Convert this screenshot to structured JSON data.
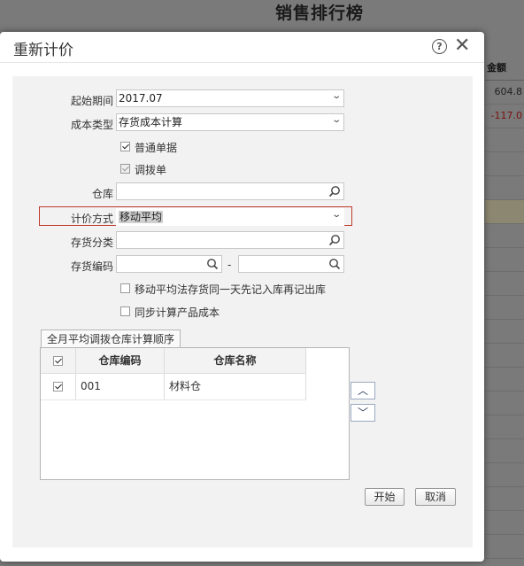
{
  "background": {
    "report_title": "销售排行榜",
    "column_header": "金额",
    "rows": [
      {
        "value": "604.8",
        "neg": false
      },
      {
        "value": "-117.0",
        "neg": true
      },
      {
        "value": "",
        "neg": false
      },
      {
        "value": "",
        "neg": false
      },
      {
        "value": "",
        "neg": false
      },
      {
        "value": "",
        "neg": false,
        "hl": true
      }
    ]
  },
  "dialog": {
    "title": "重新计价",
    "help_symbol": "?",
    "close_symbol": "✕"
  },
  "form": {
    "start_period_label": "起始期间",
    "start_period_value": "2017.07",
    "cost_type_label": "成本类型",
    "cost_type_value": "存货成本计算",
    "normal_docs_label": "普通单据",
    "transfer_docs_label": "调拨单",
    "warehouse_label": "仓库",
    "warehouse_value": "",
    "pricing_method_label": "计价方式",
    "pricing_method_value": "移动平均",
    "inventory_category_label": "存货分类",
    "inventory_category_value": "",
    "inventory_code_label": "存货编码",
    "inventory_code_from": "",
    "inventory_code_to": "",
    "range_separator": "-",
    "option_moving_avg_label": "移动平均法存货同一天先记入库再记出库",
    "option_sync_cost_label": "同步计算产品成本"
  },
  "checkbox_state": {
    "normal_docs": true,
    "transfer_docs": true,
    "option_moving_avg": false,
    "option_sync_cost": false
  },
  "grid": {
    "tab_label": "全月平均调拨仓库计算顺序",
    "headers": [
      "",
      "仓库编码",
      "仓库名称"
    ],
    "rows": [
      {
        "checked": true,
        "code": "001",
        "name": "材料仓"
      }
    ]
  },
  "move_up_symbol": "︿",
  "move_down_symbol": "﹀",
  "buttons": {
    "start": "开始",
    "cancel": "取消"
  },
  "colors": {
    "highlight_border": "#c0392b",
    "negative_value": "#b22222"
  }
}
